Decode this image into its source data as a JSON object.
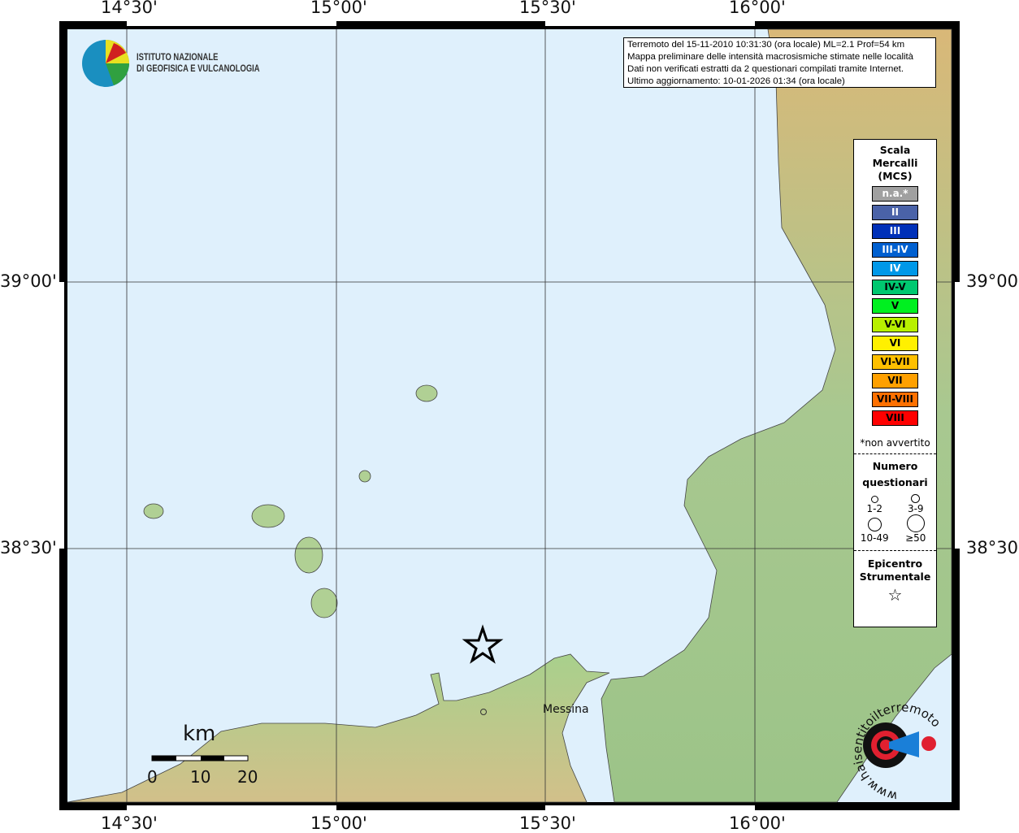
{
  "coords": {
    "lon_top": [
      "14°30'",
      "15°00'",
      "15°30'",
      "16°00'"
    ],
    "lon_bottom": [
      "14°30'",
      "15°00'",
      "15°30'",
      "16°00'"
    ],
    "lat_left": [
      "39°00'",
      "38°30'"
    ],
    "lat_right": [
      "39°00'",
      "38°30'"
    ]
  },
  "logo": {
    "line1": "ISTITUTO NAZIONALE",
    "line2": "DI GEOFISICA E VULCANOLOGIA"
  },
  "info": [
    "Terremoto del 15-11-2010 10:31:30 (ora locale) ML=2.1 Prof=54 km",
    "Mappa preliminare delle intensità macrosismiche stimate nelle località",
    "Dati non verificati estratti da 2 questionari compilati tramite Internet.",
    "Ultimo aggiornamento: 10-01-2026 01:34 (ora locale)"
  ],
  "legend": {
    "title": [
      "Scala",
      "Mercalli",
      "(MCS)"
    ],
    "scale": [
      {
        "label": "n.a.*",
        "color": "#a0a0a0",
        "text": "#ffffff"
      },
      {
        "label": "II",
        "color": "#4a62a8",
        "text": "#ffffff"
      },
      {
        "label": "III",
        "color": "#0030b8",
        "text": "#ffffff"
      },
      {
        "label": "III-IV",
        "color": "#0060d0",
        "text": "#ffffff"
      },
      {
        "label": "IV",
        "color": "#0098e8",
        "text": "#ffffff"
      },
      {
        "label": "IV-V",
        "color": "#00c870",
        "text": "#000000"
      },
      {
        "label": "V",
        "color": "#00f020",
        "text": "#000000"
      },
      {
        "label": "V-VI",
        "color": "#b8f000",
        "text": "#000000"
      },
      {
        "label": "VI",
        "color": "#fff000",
        "text": "#000000"
      },
      {
        "label": "VI-VII",
        "color": "#ffc000",
        "text": "#000000"
      },
      {
        "label": "VII",
        "color": "#ffa000",
        "text": "#000000"
      },
      {
        "label": "VII-VIII",
        "color": "#ff7000",
        "text": "#000000"
      },
      {
        "label": "VIII",
        "color": "#ff0000",
        "text": "#000000"
      }
    ],
    "note": "*non avvertito",
    "count_title": [
      "Numero",
      "questionari"
    ],
    "counts": [
      "1-2",
      "3-9",
      "10-49",
      "≥50"
    ],
    "epi_title": [
      "Epicentro",
      "Strumentale"
    ]
  },
  "places": {
    "messina": "Messina"
  },
  "scalebar": {
    "unit": "km",
    "labels": [
      "0",
      "10",
      "20"
    ]
  },
  "badge": {
    "text": "www.haisentitoilterremoto.it"
  }
}
